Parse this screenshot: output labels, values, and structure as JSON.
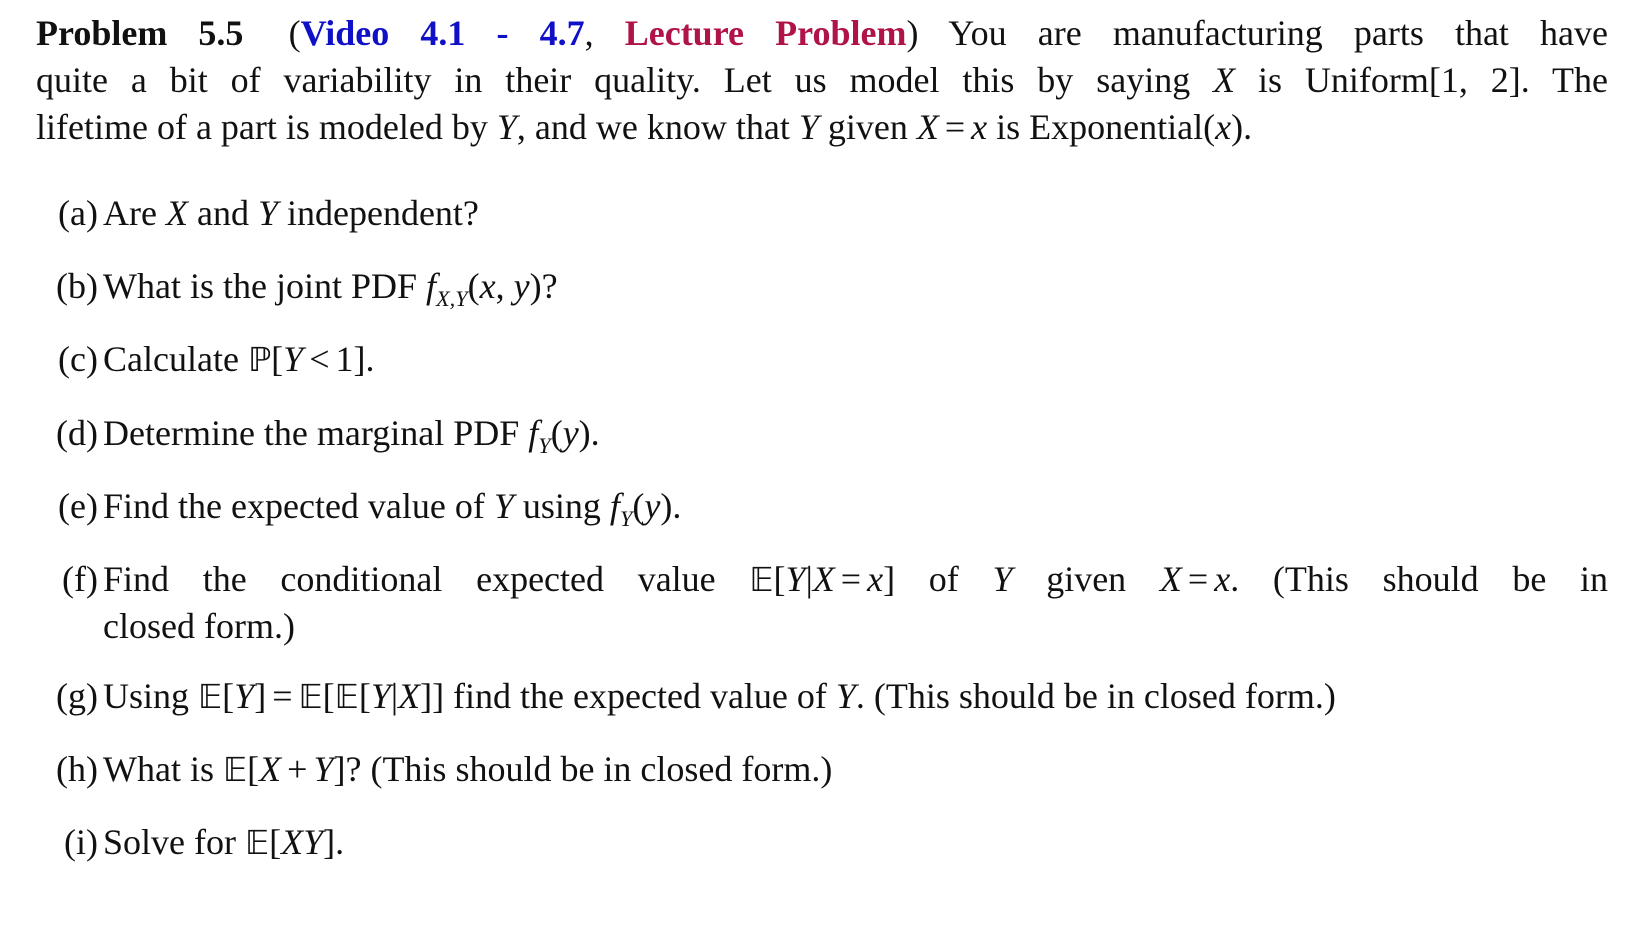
{
  "problem": {
    "label": "Problem 5.5",
    "open_paren": "(",
    "video_link": "Video 4.1 - 4.7",
    "separator": ", ",
    "lecture_link": "Lecture Problem",
    "close_paren": ")",
    "colors": {
      "video_link": "#1010c8",
      "lecture_link": "#b0124a",
      "text": "#111111"
    },
    "intro_lines": [
      [
        {
          "t": "You are manufacturing parts that have",
          "s": "n"
        }
      ],
      [
        {
          "t": "quite a bit of variability in their quality. Let us model this by saying ",
          "s": "n"
        },
        {
          "t": "X",
          "s": "i"
        },
        {
          "t": " is Uniform[1, 2]. The",
          "s": "n"
        }
      ],
      [
        {
          "t": "lifetime of a part is modeled by ",
          "s": "n"
        },
        {
          "t": "Y",
          "s": "i"
        },
        {
          "t": ", and we know that ",
          "s": "n"
        },
        {
          "t": "Y",
          "s": "i"
        },
        {
          "t": " given ",
          "s": "n"
        },
        {
          "t": "X",
          "s": "i"
        },
        {
          "t": " = ",
          "s": "op"
        },
        {
          "t": "x",
          "s": "i"
        },
        {
          "t": " is Exponential(",
          "s": "n"
        },
        {
          "t": "x",
          "s": "i"
        },
        {
          "t": ").",
          "s": "n"
        }
      ]
    ]
  },
  "parts": [
    {
      "label": "(a)",
      "lines": [
        [
          {
            "t": "Are ",
            "s": "n"
          },
          {
            "t": "X",
            "s": "i"
          },
          {
            "t": " and ",
            "s": "n"
          },
          {
            "t": "Y",
            "s": "i"
          },
          {
            "t": " independent?",
            "s": "n"
          }
        ]
      ]
    },
    {
      "label": "(b)",
      "lines": [
        [
          {
            "t": "What is the joint PDF ",
            "s": "n"
          },
          {
            "t": "f",
            "s": "i"
          },
          {
            "t": "X,Y",
            "s": "sub"
          },
          {
            "t": "(",
            "s": "n"
          },
          {
            "t": "x",
            "s": "i"
          },
          {
            "t": ", ",
            "s": "n"
          },
          {
            "t": "y",
            "s": "i"
          },
          {
            "t": ")?",
            "s": "n"
          }
        ]
      ]
    },
    {
      "label": "(c)",
      "lines": [
        [
          {
            "t": "Calculate ",
            "s": "n"
          },
          {
            "t": "ℙ",
            "s": "bb"
          },
          {
            "t": "[",
            "s": "n"
          },
          {
            "t": "Y",
            "s": "i"
          },
          {
            "t": " < ",
            "s": "op"
          },
          {
            "t": "1].",
            "s": "n"
          }
        ]
      ]
    },
    {
      "label": "(d)",
      "lines": [
        [
          {
            "t": "Determine the marginal PDF ",
            "s": "n"
          },
          {
            "t": "f",
            "s": "i"
          },
          {
            "t": "Y",
            "s": "sub"
          },
          {
            "t": "(",
            "s": "n"
          },
          {
            "t": "y",
            "s": "i"
          },
          {
            "t": ").",
            "s": "n"
          }
        ]
      ]
    },
    {
      "label": "(e)",
      "lines": [
        [
          {
            "t": "Find the expected value of ",
            "s": "n"
          },
          {
            "t": "Y",
            "s": "i"
          },
          {
            "t": " using ",
            "s": "n"
          },
          {
            "t": "f",
            "s": "i"
          },
          {
            "t": "Y",
            "s": "sub"
          },
          {
            "t": "(",
            "s": "n"
          },
          {
            "t": "y",
            "s": "i"
          },
          {
            "t": ").",
            "s": "n"
          }
        ]
      ]
    },
    {
      "label": "(f)",
      "lines": [
        [
          {
            "t": "Find the conditional expected value ",
            "s": "n"
          },
          {
            "t": "𝔼",
            "s": "bb"
          },
          {
            "t": "[",
            "s": "n"
          },
          {
            "t": "Y",
            "s": "i"
          },
          {
            "t": "|",
            "s": "n"
          },
          {
            "t": "X",
            "s": "i"
          },
          {
            "t": " = ",
            "s": "op"
          },
          {
            "t": "x",
            "s": "i"
          },
          {
            "t": "] of ",
            "s": "n"
          },
          {
            "t": "Y",
            "s": "i"
          },
          {
            "t": " given ",
            "s": "n"
          },
          {
            "t": "X",
            "s": "i"
          },
          {
            "t": " = ",
            "s": "op"
          },
          {
            "t": "x",
            "s": "i"
          },
          {
            "t": ". (This should be in",
            "s": "n"
          }
        ],
        [
          {
            "t": "closed form.)",
            "s": "n"
          }
        ]
      ]
    },
    {
      "label": "(g)",
      "lines": [
        [
          {
            "t": "Using ",
            "s": "n"
          },
          {
            "t": "𝔼",
            "s": "bb"
          },
          {
            "t": "[",
            "s": "n"
          },
          {
            "t": "Y",
            "s": "i"
          },
          {
            "t": "]",
            "s": "n"
          },
          {
            "t": " = ",
            "s": "op"
          },
          {
            "t": "𝔼",
            "s": "bb"
          },
          {
            "t": "[",
            "s": "n"
          },
          {
            "t": "𝔼",
            "s": "bb"
          },
          {
            "t": "[",
            "s": "n"
          },
          {
            "t": "Y",
            "s": "i"
          },
          {
            "t": "|",
            "s": "n"
          },
          {
            "t": "X",
            "s": "i"
          },
          {
            "t": "]] find the expected value of ",
            "s": "n"
          },
          {
            "t": "Y",
            "s": "i"
          },
          {
            "t": ". (This should be in closed form.)",
            "s": "n"
          }
        ]
      ]
    },
    {
      "label": "(h)",
      "lines": [
        [
          {
            "t": "What is ",
            "s": "n"
          },
          {
            "t": "𝔼",
            "s": "bb"
          },
          {
            "t": "[",
            "s": "n"
          },
          {
            "t": "X",
            "s": "i"
          },
          {
            "t": " + ",
            "s": "op"
          },
          {
            "t": "Y",
            "s": "i"
          },
          {
            "t": "]? (This should be in closed form.)",
            "s": "n"
          }
        ]
      ]
    },
    {
      "label": "(i)",
      "lines": [
        [
          {
            "t": "Solve for ",
            "s": "n"
          },
          {
            "t": "𝔼",
            "s": "bb"
          },
          {
            "t": "[",
            "s": "n"
          },
          {
            "t": "XY",
            "s": "i"
          },
          {
            "t": "].",
            "s": "n"
          }
        ]
      ]
    }
  ]
}
